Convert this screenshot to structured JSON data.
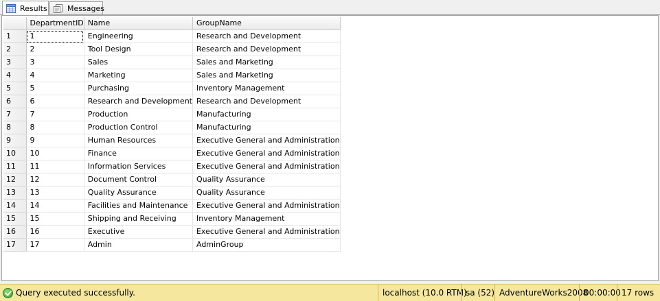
{
  "tabs": [
    {
      "label": "Results",
      "icon": "grid-icon",
      "active": true
    },
    {
      "label": "Messages",
      "icon": "messages-icon",
      "active": false
    }
  ],
  "grid": {
    "columns": [
      "DepartmentID",
      "Name",
      "GroupName"
    ],
    "rows": [
      [
        "1",
        "1",
        "Engineering",
        "Research and Development"
      ],
      [
        "2",
        "2",
        "Tool Design",
        "Research and Development"
      ],
      [
        "3",
        "3",
        "Sales",
        "Sales and Marketing"
      ],
      [
        "4",
        "4",
        "Marketing",
        "Sales and Marketing"
      ],
      [
        "5",
        "5",
        "Purchasing",
        "Inventory Management"
      ],
      [
        "6",
        "6",
        "Research and Development",
        "Research and Development"
      ],
      [
        "7",
        "7",
        "Production",
        "Manufacturing"
      ],
      [
        "8",
        "8",
        "Production Control",
        "Manufacturing"
      ],
      [
        "9",
        "9",
        "Human Resources",
        "Executive General and Administration"
      ],
      [
        "10",
        "10",
        "Finance",
        "Executive General and Administration"
      ],
      [
        "11",
        "11",
        "Information Services",
        "Executive General and Administration"
      ],
      [
        "12",
        "12",
        "Document Control",
        "Quality Assurance"
      ],
      [
        "13",
        "13",
        "Quality Assurance",
        "Quality Assurance"
      ],
      [
        "14",
        "14",
        "Facilities and Maintenance",
        "Executive General and Administration"
      ],
      [
        "15",
        "15",
        "Shipping and Receiving",
        "Inventory Management"
      ],
      [
        "16",
        "16",
        "Executive",
        "Executive General and Administration"
      ],
      [
        "17",
        "17",
        "Admin",
        "AdminGroup"
      ]
    ]
  },
  "status": {
    "message": "Query executed successfully.",
    "icon": "success-check-icon",
    "server": "localhost (10.0 RTM)",
    "user": "sa (52)",
    "database": "AdventureWorks2008",
    "elapsed": "00:00:00",
    "rows": "17 rows",
    "bar_color": "#f5e79e"
  }
}
